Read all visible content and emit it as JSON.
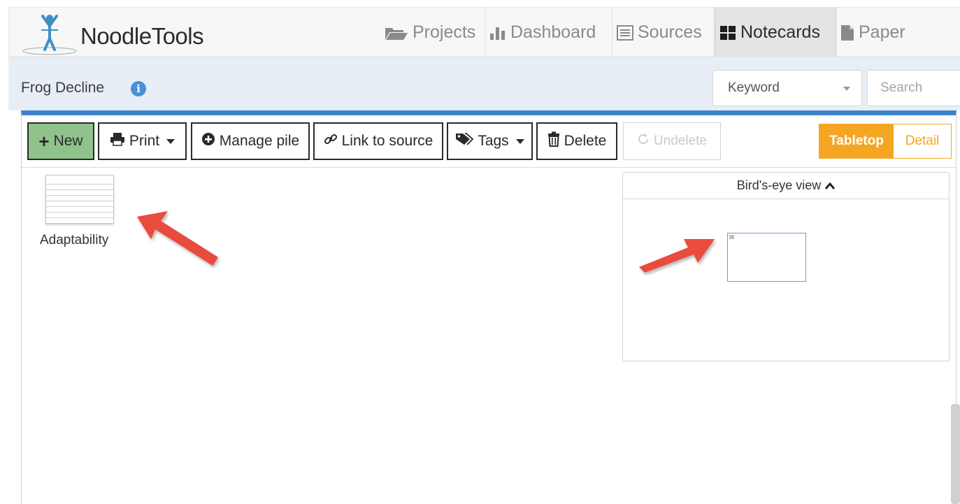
{
  "app": {
    "logo_text": "NoodleTools"
  },
  "nav": {
    "tabs": [
      {
        "label": "Projects",
        "icon": "folder-open-icon"
      },
      {
        "label": "Dashboard",
        "icon": "bar-chart-icon"
      },
      {
        "label": "Sources",
        "icon": "list-alt-icon"
      },
      {
        "label": "Notecards",
        "icon": "th-large-icon",
        "active": true
      },
      {
        "label": "Paper",
        "icon": "file-icon"
      }
    ]
  },
  "project": {
    "title": "Frog Decline"
  },
  "search": {
    "filter_selected": "Keyword",
    "placeholder": "Search"
  },
  "toolbar": {
    "new_label": "New",
    "print_label": "Print",
    "manage_pile_label": "Manage pile",
    "link_to_source_label": "Link to source",
    "tags_label": "Tags",
    "delete_label": "Delete",
    "undelete_label": "Undelete",
    "view_tabletop_label": "Tabletop",
    "view_detail_label": "Detail"
  },
  "notecards": [
    {
      "title": "Adaptability"
    }
  ],
  "birdseye": {
    "title": "Bird's-eye view"
  },
  "colors": {
    "accent_blue": "#3c84c9",
    "new_button_green": "#8fc38b",
    "toggle_orange": "#f4a623",
    "arrow_red": "#e94b3c"
  }
}
